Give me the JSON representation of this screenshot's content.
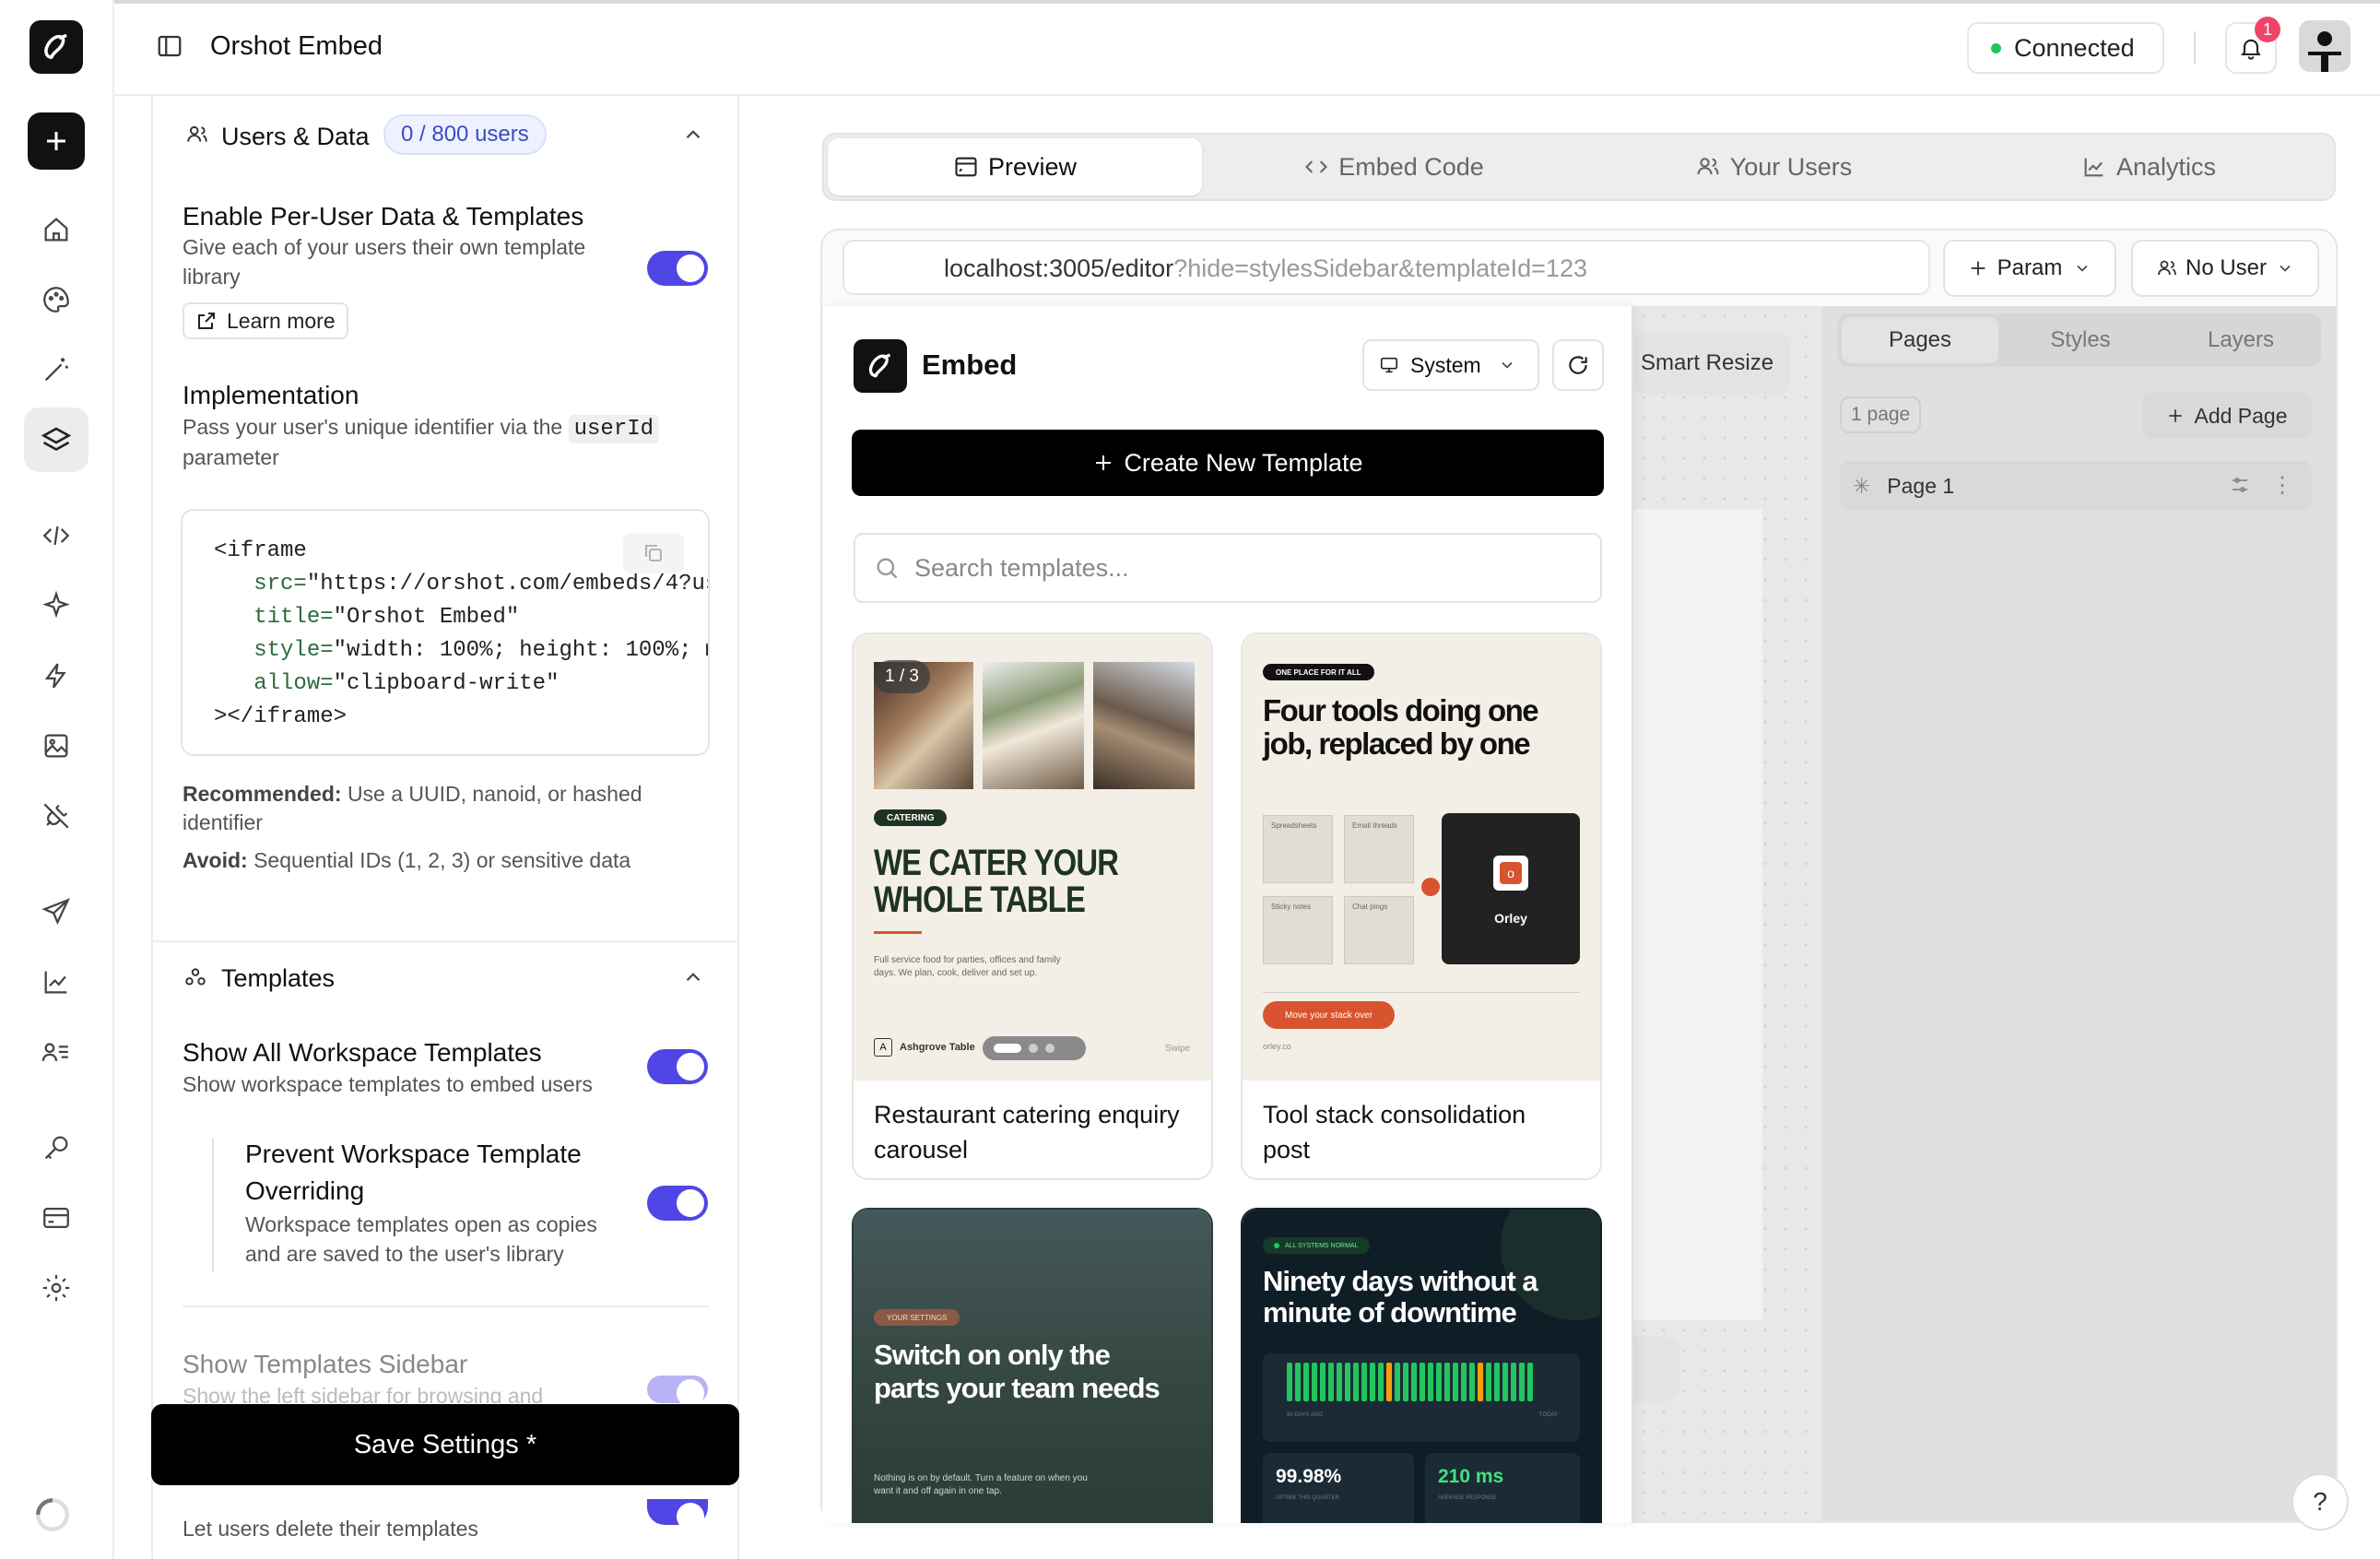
{
  "header": {
    "title": "Orshot Embed",
    "status": "Connected",
    "notif_count": "1"
  },
  "users_data": {
    "section_title": "Users & Data",
    "badge": "0 / 800 users",
    "enable_title": "Enable Per-User Data & Templates",
    "enable_desc1": "Give each of your users their own template",
    "enable_desc2": "library",
    "learn_more": "Learn more",
    "impl_title": "Implementation",
    "impl_desc1": "Pass your user's unique identifier via the",
    "impl_code": "userId",
    "impl_desc2": "parameter",
    "code": {
      "l1": "<iframe",
      "l2a": "src=",
      "l2b": "\"https://orshot.com/embeds/4?us",
      "l3a": "title=",
      "l3b": "\"Orshot Embed\"",
      "l4a": "style=",
      "l4b": "\"width: 100%; height: 100%; m",
      "l5a": "allow=",
      "l5b": "\"clipboard-write\"",
      "l6": "></iframe>"
    },
    "rec_label": "Recommended:",
    "rec_text1": "Use a UUID, nanoid, or hashed",
    "rec_text2": "identifier",
    "avoid_label": "Avoid:",
    "avoid_text": "Sequential IDs (1, 2, 3) or sensitive data"
  },
  "templates_section": {
    "title": "Templates",
    "show_all_title": "Show All Workspace Templates",
    "show_all_desc": "Show workspace templates to embed users",
    "prevent_title1": "Prevent Workspace Template",
    "prevent_title2": "Overriding",
    "prevent_desc1": "Workspace templates open as copies",
    "prevent_desc2": "and are saved to the user's library",
    "sidebar_title": "Show Templates Sidebar",
    "sidebar_desc": "Show the left sidebar for browsing and",
    "delete_desc": "Let users delete their templates"
  },
  "save_button": "Save Settings *",
  "tabs": [
    {
      "label": "Preview"
    },
    {
      "label": "Embed Code"
    },
    {
      "label": "Your Users"
    },
    {
      "label": "Analytics"
    }
  ],
  "preview": {
    "url_base": "localhost:3005/editor",
    "url_query": "?hide=stylesSidebar&templateId=123",
    "param_label": "Param",
    "user_label": "No User",
    "smart_resize": "Smart Resize",
    "right_tabs": [
      "Pages",
      "Styles",
      "Layers"
    ],
    "page_count": "1 page",
    "add_page": "Add Page",
    "page_name": "Page 1"
  },
  "embed": {
    "title": "Embed",
    "theme": "System",
    "create_btn": "Create New Template",
    "search_placeholder": "Search templates...",
    "cards": [
      {
        "title1": "Restaurant catering enquiry",
        "title2": "carousel",
        "counter": "1 / 3",
        "tag": "CATERING",
        "headline1": "WE CATER YOUR",
        "headline2": "WHOLE TABLE",
        "small1": "Full service food for parties, offices and family",
        "small2": "days. We plan, cook, deliver and set up.",
        "brand": "Ashgrove Table",
        "swipe": "Swipe"
      },
      {
        "title1": "Tool stack consolidation",
        "title2": "post",
        "tag": "ONE PLACE FOR IT ALL",
        "headline1": "Four tools doing one",
        "headline2": "job, replaced by one",
        "t1": "Spreadsheets",
        "t2": "Email threads",
        "t3": "Sticky notes",
        "t4": "Chat pings",
        "brand": "Orley",
        "cta": "Move your stack over",
        "site": "orley.co"
      },
      {
        "tag": "YOUR SETTINGS",
        "headline1": "Switch on only the",
        "headline2": "parts your team needs",
        "small1": "Nothing is on by default. Turn a feature on when you",
        "small2": "want it and off again in one tap."
      },
      {
        "tag": "ALL SYSTEMS NORMAL",
        "headline1": "Ninety days without a",
        "headline2": "minute of downtime",
        "l_left": "90 DAYS AGO",
        "l_right": "TODAY",
        "stat1": "99.98%",
        "stat1_label": "UPTIME THIS QUARTER",
        "stat2": "210 ms",
        "stat2_label": "AVERAGE RESPONSE"
      }
    ]
  },
  "colors": {
    "accent": "#4f46e5",
    "orange": "#d8542e",
    "green": "#22c55e",
    "dark": "#111111"
  }
}
